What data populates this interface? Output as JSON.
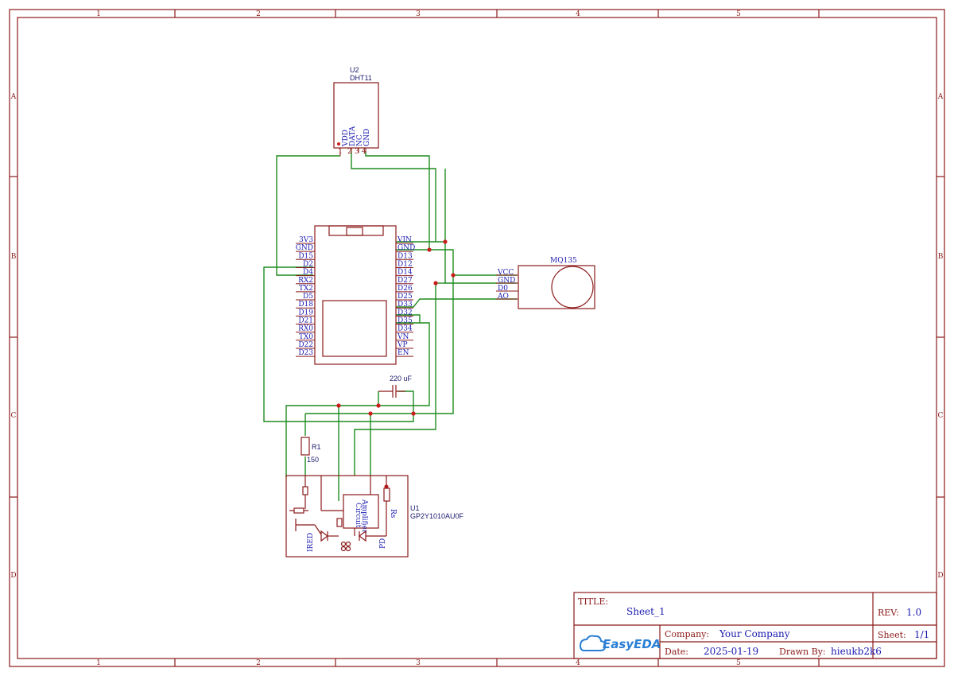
{
  "sheet": {
    "columns": [
      "1",
      "2",
      "3",
      "4",
      "5"
    ],
    "rows": [
      "A",
      "B",
      "C",
      "D"
    ]
  },
  "components": {
    "dht11": {
      "designator": "U2",
      "name": "DHT11",
      "pins": [
        "VDD",
        "DATA",
        "NC",
        "GND"
      ],
      "pin_numbers": [
        "1",
        "2",
        "3",
        "4"
      ]
    },
    "esp32": {
      "left_pins": [
        "3V3",
        "GND",
        "D15",
        "D2",
        "D4",
        "RX2",
        "TX2",
        "D5",
        "D18",
        "D19",
        "D21",
        "RX0",
        "TX0",
        "D22",
        "D23"
      ],
      "right_pins": [
        "VIN",
        "GND",
        "D13",
        "D12",
        "D14",
        "D27",
        "D26",
        "D25",
        "D33",
        "D32",
        "D35",
        "D34",
        "VN",
        "VP",
        "EN"
      ]
    },
    "mq135": {
      "name": "MQ135",
      "pins": [
        "VCC",
        "GND",
        "D0",
        "AO"
      ]
    },
    "capacitor": {
      "value": "220 uF"
    },
    "resistor": {
      "designator": "R1",
      "value": "150"
    },
    "dust_sensor": {
      "designator": "U1",
      "name": "GP2Y1010AU0F",
      "ired_label": "IRED",
      "pd_label": "PD",
      "amp_label": "Amplifier",
      "amp_label2": "Circuit",
      "rs_label": "Rs"
    }
  },
  "title_block": {
    "title_label": "TITLE:",
    "title": "Sheet_1",
    "rev_label": "REV:",
    "rev": "1.0",
    "company_label": "Company:",
    "company": "Your Company",
    "sheet_label": "Sheet:",
    "sheet": "1/1",
    "date_label": "Date:",
    "date": "2025-01-19",
    "drawn_label": "Drawn By:",
    "drawn_by": "hieukb2k6",
    "logo_text": "EasyEDA"
  },
  "colors": {
    "frame": "#8b1a1a",
    "wire": "#1e8c1e",
    "pin_label": "#1a1ab0",
    "junction": "#c81e1e"
  }
}
